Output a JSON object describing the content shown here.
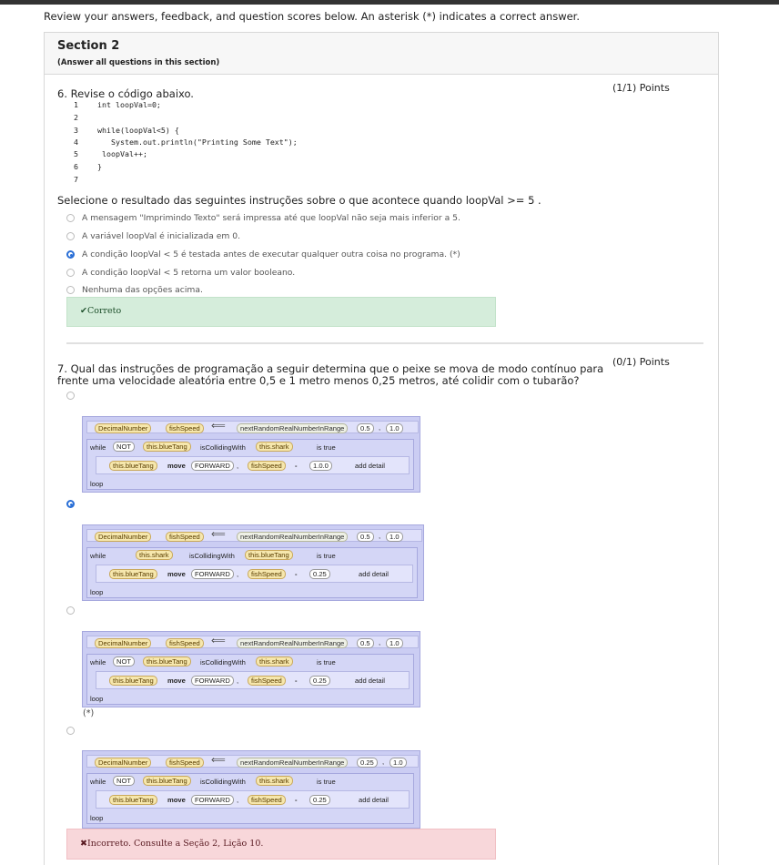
{
  "intro": "Review your answers, feedback, and question scores below. An asterisk (*) indicates a correct answer.",
  "section": {
    "title": "Section 2",
    "subtitle": "(Answer all questions in this section)"
  },
  "q6": {
    "points": "(1/1) Points",
    "prompt": "6. Revise o código abaixo.",
    "code_lines": [
      {
        "n": "1",
        "t": "int loopVal=0;"
      },
      {
        "n": "2",
        "t": ""
      },
      {
        "n": "3",
        "t": "while(loopVal<5) {"
      },
      {
        "n": "4",
        "t": "   System.out.println(\"Printing Some Text\");"
      },
      {
        "n": "5",
        "t": " loopVal++;"
      },
      {
        "n": "6",
        "t": "}"
      },
      {
        "n": "7",
        "t": ""
      }
    ],
    "question": "Selecione o resultado das seguintes instruções sobre o que acontece quando loopVal >= 5 .",
    "options": [
      "A mensagem \"Imprimindo Texto\" será impressa até que loopVal não seja mais inferior a 5.",
      "A variável loopVal é inicializada em 0.",
      "A condição loopVal < 5 é testada antes de executar qualquer outra coisa no programa. (*)",
      "A condição loopVal < 5 retorna um valor booleano.",
      "Nenhuma das opções acima."
    ],
    "selected_index": 2,
    "feedback": "✔Correto"
  },
  "q7": {
    "points": "(0/1) Points",
    "prompt_line1": "7. Qual das instruções de programação a seguir determina que o peixe se mova de modo contínuo para",
    "prompt_line2": "frente uma velocidade aleatória entre 0,5 e 1 metro menos 0,25 metros, até colidir com o tubarão?",
    "selected_index": 1,
    "correct_marker": "(*)",
    "feedback": "✖Incorreto. Consulte a Seção 2, Lição 10.",
    "block_text": {
      "decimal": "DecimalNumber",
      "fishSpeed": "fishSpeed",
      "random": "nextRandomRealNumberInRange",
      "while": "while",
      "not": "NOT",
      "colliding": "isCollidingWith",
      "istrue": "is true",
      "move": "move",
      "forward": "FORWARD",
      "minus": "-",
      "adddetail": "add detail",
      "loop": "loop",
      "comma": ","
    },
    "blocks": [
      {
        "lo": "0.5",
        "hi": "1.0",
        "not": true,
        "subj": "this.blueTang",
        "obj": "this.shark",
        "mover": "this.blueTang",
        "amount": "1.0.0"
      },
      {
        "lo": "0.5",
        "hi": "1.0",
        "not": true,
        "subj": "this.shark",
        "obj": "this.blueTang",
        "mover": "this.blueTang",
        "amount": "0.25"
      },
      {
        "lo": "0.5",
        "hi": "1.0",
        "not": true,
        "subj": "this.blueTang",
        "obj": "this.shark",
        "mover": "this.blueTang",
        "amount": "0.25"
      },
      {
        "lo": "0.25",
        "hi": "1.0",
        "not": true,
        "subj": "this.blueTang",
        "obj": "this.shark",
        "mover": "this.blueTang",
        "amount": "0.25"
      }
    ]
  },
  "colors": {
    "accent": "#2a6fd6",
    "correct_bg": "#d5eddb",
    "incorrect_bg": "#f8d7da",
    "block_bg": "#cbcdf3"
  }
}
